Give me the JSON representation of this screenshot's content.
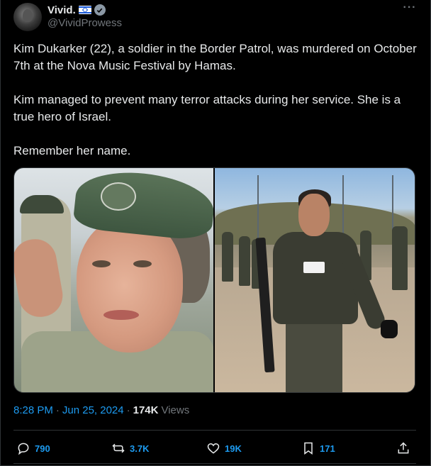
{
  "author": {
    "display_name": "Vivid.",
    "handle": "@VividProwess",
    "flag_icon": "israel-flag-icon",
    "verified_icon": "verified-badge-icon"
  },
  "more_icon": "more-options-icon",
  "more_label": "···",
  "post": {
    "paragraphs": [
      "Kim Dukarker (22), a soldier in the Border Patrol, was murdered on October 7th at the Nova Music Festival by Hamas.",
      "Kim managed to prevent many terror attacks during her service. She is a true hero of Israel.",
      "Remember her name."
    ]
  },
  "media": {
    "images": [
      {
        "name": "photo-left-portrait-salute"
      },
      {
        "name": "photo-right-marching-soldiers"
      }
    ]
  },
  "meta": {
    "time": "8:28 PM",
    "separator": "·",
    "date": "Jun 25, 2024",
    "separator2": "·",
    "views_count": "174K",
    "views_label": "Views"
  },
  "actions": {
    "reply": {
      "icon": "reply-icon",
      "count": "790"
    },
    "repost": {
      "icon": "repost-icon",
      "count": "3.7K"
    },
    "like": {
      "icon": "heart-icon",
      "count": "19K"
    },
    "bookmark": {
      "icon": "bookmark-icon",
      "count": "171"
    },
    "share": {
      "icon": "share-icon"
    }
  },
  "colors": {
    "background": "#000000",
    "text": "#e7e9ea",
    "muted": "#71767b",
    "accent": "#1d9bf0",
    "border": "#2f3336"
  }
}
